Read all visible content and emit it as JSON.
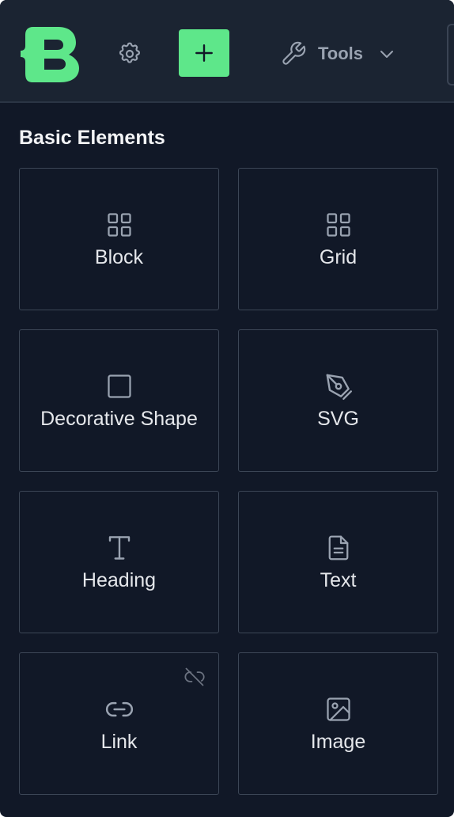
{
  "toolbar": {
    "logo_icon": "brand-logo-icon",
    "settings_icon": "gear-icon",
    "add_icon": "plus-icon",
    "tools_icon": "wrench-icon",
    "tools_label": "Tools",
    "tools_chevron_icon": "chevron-down-icon"
  },
  "section": {
    "title": "Basic Elements"
  },
  "elements": [
    {
      "label": "Block",
      "icon": "grid-squares-icon"
    },
    {
      "label": "Grid",
      "icon": "grid-squares-icon"
    },
    {
      "label": "Decorative Shape",
      "icon": "square-icon"
    },
    {
      "label": "SVG",
      "icon": "pen-nib-icon"
    },
    {
      "label": "Heading",
      "icon": "heading-t-icon"
    },
    {
      "label": "Text",
      "icon": "document-text-icon"
    },
    {
      "label": "Link",
      "icon": "link-icon",
      "badge_icon": "unlink-icon"
    },
    {
      "label": "Image",
      "icon": "image-icon"
    }
  ],
  "colors": {
    "panel_background": "#111827",
    "toolbar_background": "#1b2432",
    "accent_green": "#5ee78a",
    "tile_border": "#3c4656",
    "icon_muted": "#9aa3b1",
    "text_primary": "#e5e7eb"
  }
}
